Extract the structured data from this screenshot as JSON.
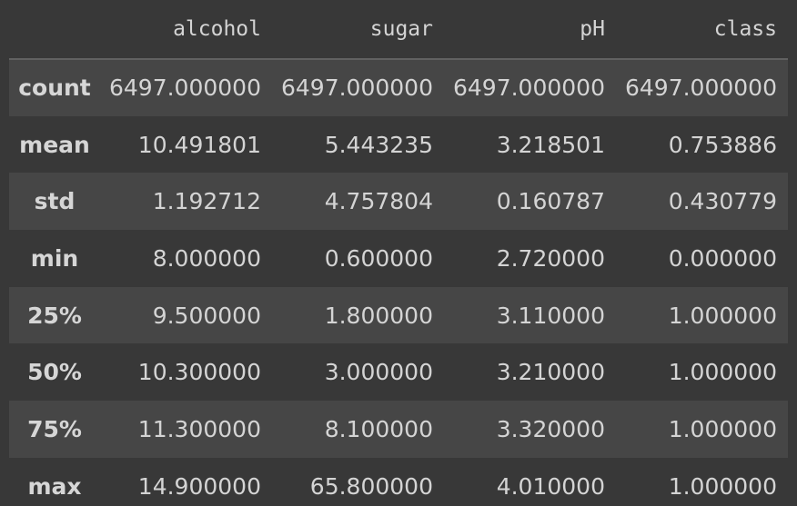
{
  "table": {
    "columns": [
      "alcohol",
      "sugar",
      "pH",
      "class"
    ],
    "rows": [
      {
        "label": "count",
        "values": [
          "6497.000000",
          "6497.000000",
          "6497.000000",
          "6497.000000"
        ]
      },
      {
        "label": "mean",
        "values": [
          "10.491801",
          "5.443235",
          "3.218501",
          "0.753886"
        ]
      },
      {
        "label": "std",
        "values": [
          "1.192712",
          "4.757804",
          "0.160787",
          "0.430779"
        ]
      },
      {
        "label": "min",
        "values": [
          "8.000000",
          "0.600000",
          "2.720000",
          "0.000000"
        ]
      },
      {
        "label": "25%",
        "values": [
          "9.500000",
          "1.800000",
          "3.110000",
          "1.000000"
        ]
      },
      {
        "label": "50%",
        "values": [
          "10.300000",
          "3.000000",
          "3.210000",
          "1.000000"
        ]
      },
      {
        "label": "75%",
        "values": [
          "11.300000",
          "8.100000",
          "3.320000",
          "1.000000"
        ]
      },
      {
        "label": "max",
        "values": [
          "14.900000",
          "65.800000",
          "4.010000",
          "1.000000"
        ]
      }
    ]
  }
}
